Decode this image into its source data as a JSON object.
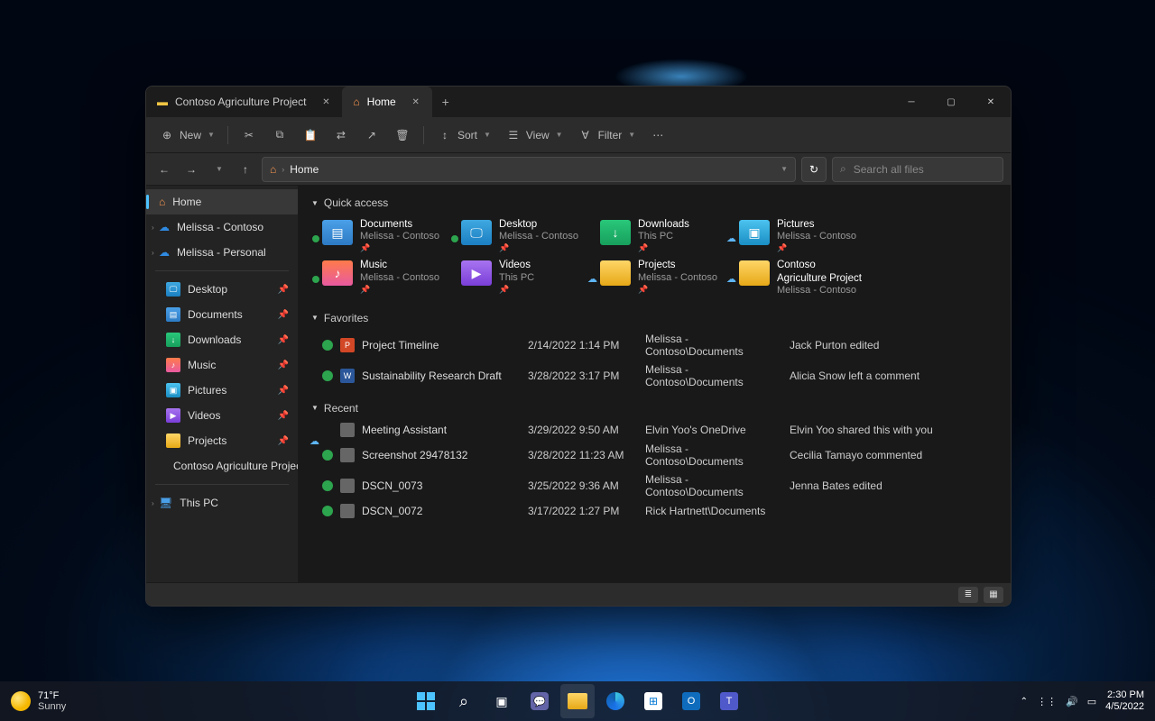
{
  "window": {
    "tabs": [
      {
        "label": "Contoso Agriculture Project",
        "active": false
      },
      {
        "label": "Home",
        "active": true
      }
    ]
  },
  "toolbar": {
    "new": "New",
    "sort": "Sort",
    "view": "View",
    "filter": "Filter"
  },
  "address": {
    "path": "Home",
    "search_placeholder": "Search all files"
  },
  "sidebar": {
    "home": "Home",
    "accounts": [
      {
        "label": "Melissa - Contoso"
      },
      {
        "label": "Melissa - Personal"
      }
    ],
    "pinned": [
      {
        "label": "Desktop",
        "icon": "desk"
      },
      {
        "label": "Documents",
        "icon": "docs"
      },
      {
        "label": "Downloads",
        "icon": "down"
      },
      {
        "label": "Music",
        "icon": "music"
      },
      {
        "label": "Pictures",
        "icon": "pics"
      },
      {
        "label": "Videos",
        "icon": "video"
      },
      {
        "label": "Projects",
        "icon": "folder"
      },
      {
        "label": "Contoso Agriculture Project",
        "icon": "folder",
        "nopin": true
      }
    ],
    "thispc": "This PC"
  },
  "sections": {
    "quick_access": "Quick access",
    "favorites": "Favorites",
    "recent": "Recent"
  },
  "quick_access": [
    {
      "name": "Documents",
      "sub": "Melissa - Contoso",
      "icon": "docs",
      "status": "green"
    },
    {
      "name": "Desktop",
      "sub": "Melissa - Contoso",
      "icon": "desk",
      "status": "green"
    },
    {
      "name": "Downloads",
      "sub": "This PC",
      "icon": "down",
      "status": ""
    },
    {
      "name": "Pictures",
      "sub": "Melissa - Contoso",
      "icon": "pics",
      "status": "cloud"
    },
    {
      "name": "Music",
      "sub": "Melissa - Contoso",
      "icon": "music",
      "status": "green"
    },
    {
      "name": "Videos",
      "sub": "This PC",
      "icon": "video",
      "status": ""
    },
    {
      "name": "Projects",
      "sub": "Melissa - Contoso",
      "icon": "folder",
      "status": "cloud"
    },
    {
      "name": "Contoso Agriculture Project",
      "sub": "Melissa - Contoso",
      "icon": "folder",
      "status": "cloud",
      "nopin": true
    }
  ],
  "favorites": [
    {
      "name": "Project Timeline",
      "date": "2/14/2022 1:14 PM",
      "loc": "Melissa - Contoso\\Documents",
      "act": "Jack Purton edited",
      "icon": "ppt",
      "status": "green"
    },
    {
      "name": "Sustainability Research Draft",
      "date": "3/28/2022 3:17 PM",
      "loc": "Melissa - Contoso\\Documents",
      "act": "Alicia Snow left a comment",
      "icon": "word",
      "status": "green"
    }
  ],
  "recent": [
    {
      "name": "Meeting Assistant",
      "date": "3/29/2022 9:50 AM",
      "loc": "Elvin Yoo's OneDrive",
      "act": "Elvin Yoo shared this with you",
      "icon": "generic",
      "status": "cloud"
    },
    {
      "name": "Screenshot 29478132",
      "date": "3/28/2022 11:23 AM",
      "loc": "Melissa - Contoso\\Documents",
      "act": "Cecilia Tamayo commented",
      "icon": "generic",
      "status": "green"
    },
    {
      "name": "DSCN_0073",
      "date": "3/25/2022 9:36 AM",
      "loc": "Melissa - Contoso\\Documents",
      "act": "Jenna Bates edited",
      "icon": "generic",
      "status": "green"
    },
    {
      "name": "DSCN_0072",
      "date": "3/17/2022 1:27 PM",
      "loc": "Rick Hartnett\\Documents",
      "act": "",
      "icon": "generic",
      "status": "green"
    }
  ],
  "taskbar": {
    "temp": "71°F",
    "cond": "Sunny",
    "time": "2:30 PM",
    "date": "4/5/2022"
  }
}
